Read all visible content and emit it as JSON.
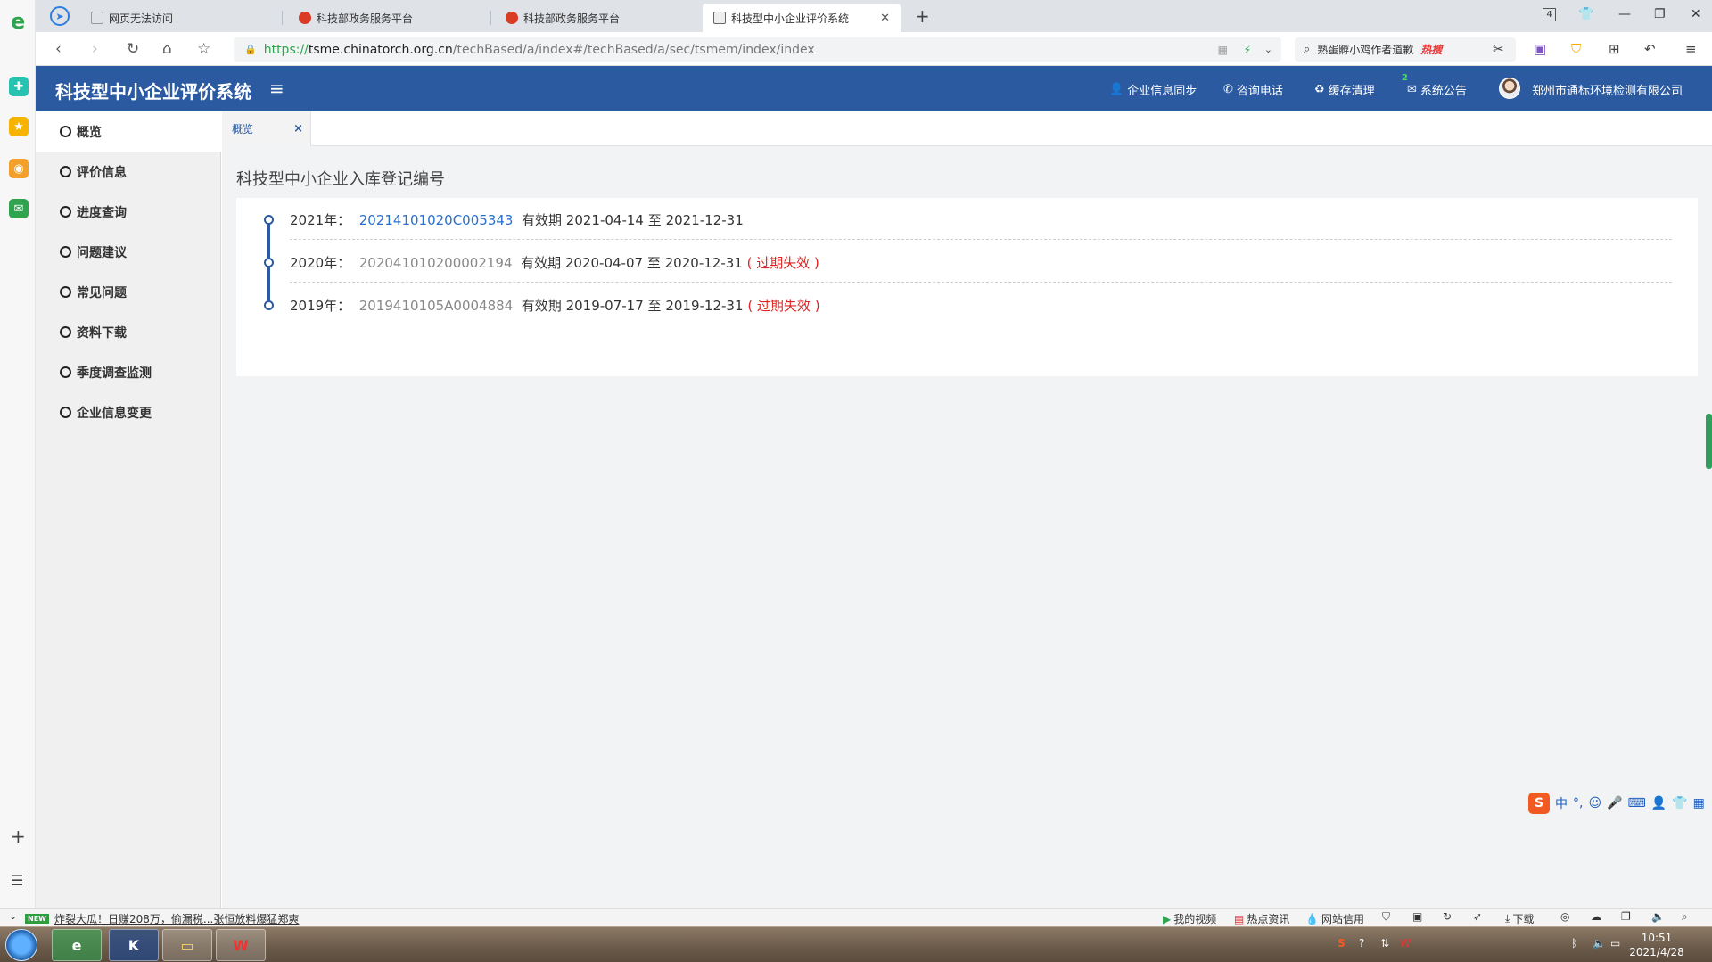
{
  "browser": {
    "tabs": [
      {
        "label": "网页无法访问"
      },
      {
        "label": "科技部政务服务平台"
      },
      {
        "label": "科技部政务服务平台"
      },
      {
        "label": "科技型中小企业评价系统"
      }
    ],
    "tab_count": "4",
    "url": {
      "scheme": "https://",
      "host": "tsme.chinatorch.org.cn",
      "path": "/techBased/a/index#/techBased/a/sec/tsmem/index/index"
    },
    "search_text": "熟蛋孵小鸡作者道歉",
    "search_hot": "热搜",
    "status_news": "炸裂大瓜！日赚208万，偷漏税...张恒放料爆猛郑爽",
    "status_new_tag": "NEW",
    "status_items": [
      "我的视频",
      "热点资讯",
      "网站信用",
      "下载"
    ]
  },
  "app": {
    "title": "科技型中小企业评价系统",
    "header_links": [
      "企业信息同步",
      "咨询电话",
      "缓存清理",
      "系统公告"
    ],
    "notice_count": "2",
    "company": "郑州市通标环境检测有限公司"
  },
  "sidebar": {
    "items": [
      {
        "label": "概览"
      },
      {
        "label": "评价信息"
      },
      {
        "label": "进度查询"
      },
      {
        "label": "问题建议"
      },
      {
        "label": "常见问题"
      },
      {
        "label": "资料下载"
      },
      {
        "label": "季度调查监测"
      },
      {
        "label": "企业信息变更"
      }
    ]
  },
  "content": {
    "tab_label": "概览",
    "tab_close": "×",
    "section_title": "科技型中小企业入库登记编号",
    "validity_label": "有效期",
    "to_label": "至",
    "records": [
      {
        "year": "2021年：",
        "code": "20214101020C005343",
        "start": "2021-04-14",
        "end": "2021-12-31",
        "status": ""
      },
      {
        "year": "2020年：",
        "code": "202041010200002194",
        "start": "2020-04-07",
        "end": "2020-12-31",
        "status": "( 过期失效 )"
      },
      {
        "year": "2019年：",
        "code": "2019410105A0004884",
        "start": "2019-07-17",
        "end": "2019-12-31",
        "status": "( 过期失效 )"
      }
    ]
  },
  "ime": {
    "logo": "S",
    "lang": "中"
  },
  "taskbar": {
    "time": "10:51",
    "date": "2021/4/28"
  },
  "colors": {
    "header_blue": "#2b5aa0",
    "link_blue": "#2b6fc8",
    "expired_red": "#e02424"
  }
}
